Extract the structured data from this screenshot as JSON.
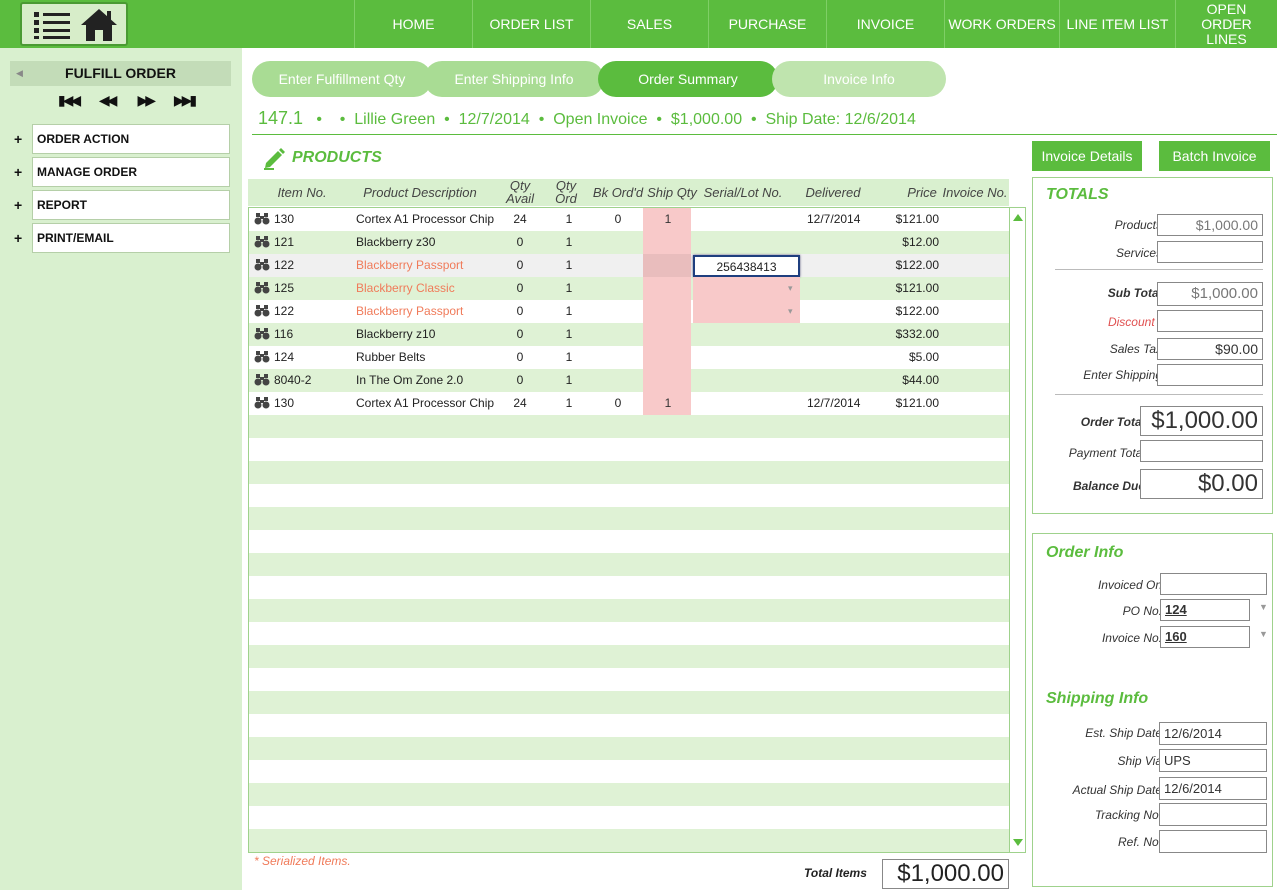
{
  "nav": {
    "items": [
      "HOME",
      "ORDER LIST",
      "SALES",
      "PURCHASE",
      "INVOICE",
      "WORK ORDERS",
      "LINE ITEM LIST",
      "OPEN ORDER LINES"
    ]
  },
  "sidebar": {
    "title": "FULFILL ORDER",
    "items": [
      {
        "plus": "+",
        "label": "ORDER ACTION"
      },
      {
        "plus": "+",
        "label": "MANAGE ORDER"
      },
      {
        "plus": "+",
        "label": "REPORT"
      },
      {
        "plus": "+",
        "label": "PRINT/EMAIL"
      }
    ]
  },
  "steps": [
    "Enter Fulfillment Qty",
    "Enter Shipping Info",
    "Order Summary",
    "Invoice Info"
  ],
  "header": {
    "order_no": "147.1",
    "customer": "Lillie Green",
    "date": "12/7/2014",
    "status": "Open Invoice",
    "amount": "$1,000.00",
    "ship_date": "Ship Date: 12/6/2014"
  },
  "products": {
    "title": "PRODUCTS",
    "columns": {
      "item_no": "Item No.",
      "desc": "Product Description",
      "qty_avail": "Qty Avail",
      "qty_ord": "Qty Ord",
      "bk_ord": "Bk Ord'd",
      "ship_qty": "Ship Qty",
      "serial": "Serial/Lot No.",
      "delivered": "Delivered",
      "price": "Price",
      "invoice_no": "Invoice No."
    },
    "rows": [
      {
        "item": "130",
        "desc": "Cortex A1 Processor Chip",
        "serialized": false,
        "avail": "24",
        "ord": "1",
        "bk": "0",
        "ship": "1",
        "serial": "",
        "delivered": "12/7/2014",
        "price": "$121.00"
      },
      {
        "item": "121",
        "desc": "Blackberry z30",
        "serialized": false,
        "avail": "0",
        "ord": "1",
        "bk": "",
        "ship": "",
        "serial": "",
        "delivered": "",
        "price": "$12.00"
      },
      {
        "item": "122",
        "desc": "Blackberry Passport",
        "serialized": true,
        "avail": "0",
        "ord": "1",
        "bk": "",
        "ship": "",
        "serial": "256438413",
        "delivered": "",
        "price": "$122.00"
      },
      {
        "item": "125",
        "desc": "Blackberry Classic",
        "serialized": true,
        "avail": "0",
        "ord": "1",
        "bk": "",
        "ship": "",
        "serial": "",
        "delivered": "",
        "price": "$121.00"
      },
      {
        "item": "122",
        "desc": "Blackberry Passport",
        "serialized": true,
        "avail": "0",
        "ord": "1",
        "bk": "",
        "ship": "",
        "serial": "",
        "delivered": "",
        "price": "$122.00"
      },
      {
        "item": "116",
        "desc": "Blackberry z10",
        "serialized": false,
        "avail": "0",
        "ord": "1",
        "bk": "",
        "ship": "",
        "serial": "",
        "delivered": "",
        "price": "$332.00"
      },
      {
        "item": "124",
        "desc": "Rubber Belts",
        "serialized": false,
        "avail": "0",
        "ord": "1",
        "bk": "",
        "ship": "",
        "serial": "",
        "delivered": "",
        "price": "$5.00"
      },
      {
        "item": "8040-2",
        "desc": "In The Om Zone 2.0",
        "serialized": false,
        "avail": "0",
        "ord": "1",
        "bk": "",
        "ship": "",
        "serial": "",
        "delivered": "",
        "price": "$44.00"
      },
      {
        "item": "130",
        "desc": "Cortex A1 Processor Chip",
        "serialized": false,
        "avail": "24",
        "ord": "1",
        "bk": "0",
        "ship": "1",
        "serial": "",
        "delivered": "12/7/2014",
        "price": "$121.00"
      }
    ],
    "serial_note": "* Serialized Items.",
    "total_items_label": "Total Items",
    "total_items_value": "$1,000.00"
  },
  "buttons": {
    "invoice_details": "Invoice Details",
    "batch_invoice": "Batch Invoice"
  },
  "totals": {
    "title": "TOTALS",
    "products_label": "Products",
    "products_value": "$1,000.00",
    "services_label": "Services",
    "services_value": "",
    "subtotal_label": "Sub Total",
    "subtotal_value": "$1,000.00",
    "discount_label": "Discount -",
    "discount_value": "",
    "sales_tax_label": "Sales Tax",
    "sales_tax_value": "$90.00",
    "shipping_label": "Enter Shipping",
    "shipping_value": "",
    "order_total_label": "Order Total",
    "order_total_value": "$1,000.00",
    "payment_total_label": "Payment Total",
    "payment_total_value": "",
    "balance_due_label": "Balance Due",
    "balance_due_value": "$0.00"
  },
  "order_info": {
    "title": "Order  Info",
    "invoiced_on_label": "Invoiced On",
    "invoiced_on_value": "",
    "po_label": "PO No.",
    "po_value": "124",
    "invoice_no_label": "Invoice No.",
    "invoice_no_value": "160"
  },
  "shipping_info": {
    "title": "Shipping Info",
    "est_ship_label": "Est. Ship Date",
    "est_ship_value": "12/6/2014",
    "ship_via_label": "Ship Via",
    "ship_via_value": "UPS",
    "actual_ship_label": "Actual Ship Date",
    "actual_ship_value": "12/6/2014",
    "tracking_label": "Tracking No.",
    "tracking_value": "",
    "ref_label": "Ref. No.",
    "ref_value": ""
  },
  "colors": {
    "brand_green": "#5bbc3e",
    "light_green": "#d9f0cf",
    "serialized_orange": "#f07b5a",
    "ship_pink": "#f8c9c9"
  }
}
